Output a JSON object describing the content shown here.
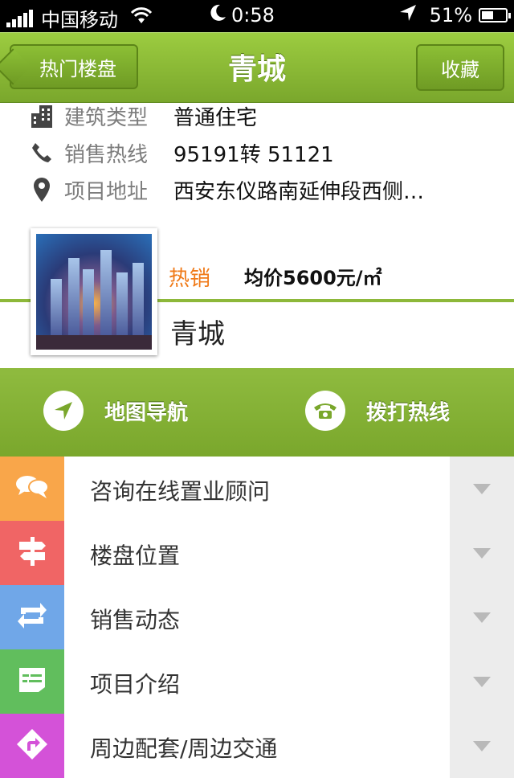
{
  "status_bar": {
    "carrier": "中国移动",
    "time": "0:58",
    "battery": "51%",
    "battery_level": 0.51
  },
  "nav": {
    "back_label": "热门楼盘",
    "title": "青城",
    "favorite_label": "收藏"
  },
  "info": {
    "rows": [
      {
        "icon": "building-icon",
        "label": "建筑类型",
        "value": "普通住宅"
      },
      {
        "icon": "phone-icon",
        "label": "销售热线",
        "value": "95191转 51121"
      },
      {
        "icon": "location-pin-icon",
        "label": "项目地址",
        "value": "西安东仪路南延伸段西侧…"
      }
    ],
    "status": "热销",
    "price": "均价5600元/㎡",
    "name": "青城"
  },
  "actions": {
    "map_nav": "地图导航",
    "call_hotline": "拨打热线"
  },
  "menu": [
    {
      "icon": "chat-bubbles-icon",
      "color": "#f9a64a",
      "label": "咨询在线置业顾问"
    },
    {
      "icon": "signpost-icon",
      "color": "#f06565",
      "label": "楼盘位置"
    },
    {
      "icon": "refresh-arrows-icon",
      "color": "#70a7e8",
      "label": "销售动态"
    },
    {
      "icon": "document-card-icon",
      "color": "#61be5d",
      "label": "项目介绍"
    },
    {
      "icon": "direction-turn-icon",
      "color": "#d452d8",
      "label": "周边配套/周边交通"
    }
  ],
  "colors": {
    "brand_green": "#7aa72c",
    "hot_orange": "#f07a18"
  }
}
